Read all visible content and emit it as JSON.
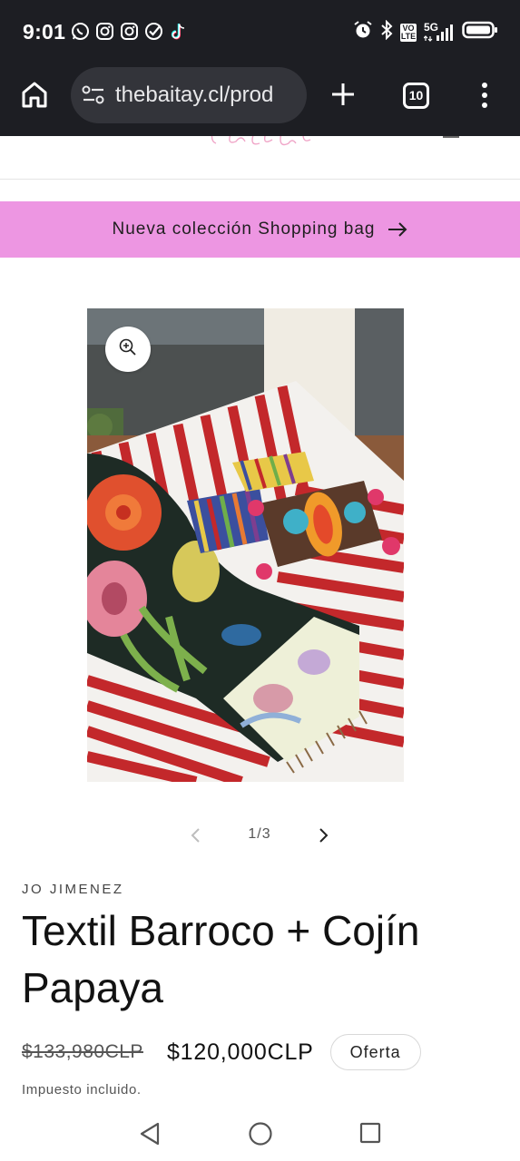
{
  "status_bar": {
    "time": "9:01",
    "notification_icons": [
      "whatsapp-icon",
      "instagram-icon",
      "instagram-icon",
      "check-circle-icon",
      "tiktok-icon"
    ],
    "system_icons": [
      "alarm-icon",
      "bluetooth-icon",
      "volte-icon",
      "signal-5g-icon",
      "battery-icon"
    ],
    "volte_text": "VO LTE",
    "network_text": "5G"
  },
  "browser": {
    "url": "thebaitay.cl/prod",
    "tab_count": "10",
    "icons": [
      "home-icon",
      "site-settings-icon",
      "new-tab-plus-icon",
      "tab-switcher-icon",
      "more-menu-icon"
    ]
  },
  "announcement": {
    "text": "Nueva colección Shopping bag",
    "icon": "arrow-right-icon"
  },
  "gallery": {
    "current": 1,
    "total": 3,
    "counter_text": "1/3",
    "zoom_icon": "zoom-in-icon"
  },
  "product": {
    "vendor": "JO JIMENEZ",
    "title": "Textil Barroco + Cojín Papaya",
    "compare_price": "$133,980CLP",
    "price": "$120,000CLP",
    "badge": "Oferta",
    "tax_note": "Impuesto incluido."
  },
  "android_nav": {
    "icons": [
      "back-triangle-icon",
      "home-circle-icon",
      "recents-square-icon"
    ]
  },
  "colors": {
    "chrome_bg": "#1d1e23",
    "url_bar_bg": "#33343a",
    "announcement_bg": "#ed96e2",
    "page_bg": "#ffffff",
    "text": "#121212"
  }
}
